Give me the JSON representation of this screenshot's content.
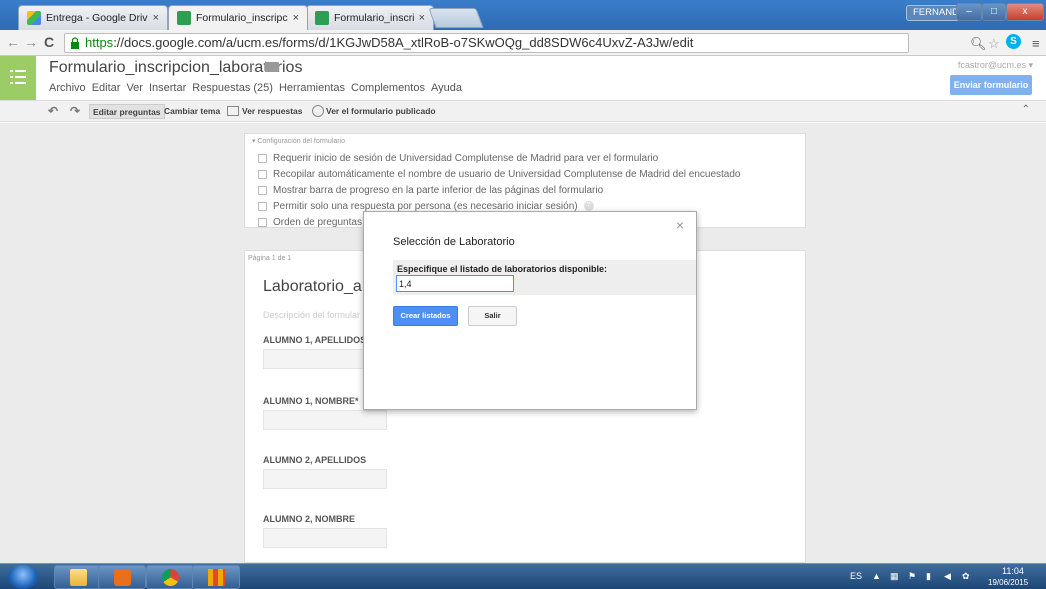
{
  "browser": {
    "tabs": [
      {
        "label": "Entrega - Google Drive",
        "close": "×"
      },
      {
        "label": "Formulario_inscripcion_lal",
        "close": "×"
      },
      {
        "label": "Formulario_inscripcion_lal",
        "close": "×"
      }
    ],
    "user": "FERNANDO",
    "url_scheme": "https",
    "url_rest": "://docs.google.com/a/ucm.es/forms/d/1KGJwD58A_xtlRoB-o7SKwOQg_dd8SDW6c4UxvZ-A3Jw/edit",
    "window_buttons": [
      "–",
      "□",
      "x"
    ]
  },
  "forms": {
    "doc_title": "Formulario_inscripcion_laboratorios",
    "star": "☆",
    "menu": [
      "Archivo",
      "Editar",
      "Ver",
      "Insertar",
      "Respuestas (25)",
      "Herramientas",
      "Complementos",
      "Ayuda"
    ],
    "account_email": "fcastror@ucm.es ▾",
    "send_label": "Enviar formulario"
  },
  "toolbar": {
    "undo": "↶",
    "redo": "↷",
    "edit_questions": "Editar preguntas",
    "change_theme": "Cambiar tema",
    "view_responses": "Ver respuestas",
    "view_published": "Ver el formulario publicado",
    "collapse": "⌃"
  },
  "settings": {
    "title": "▾ Configuración del formulario",
    "options": [
      "Requerir inicio de sesión de Universidad Complutense de Madrid para ver el formulario",
      "Recopilar automáticamente el nombre de usuario de Universidad Complutense de Madrid del encuestado",
      "Mostrar barra de progreso en la parte inferior de las páginas del formulario",
      "Permitir solo una respuesta por persona (es necesario iniciar sesión)",
      "Orden de preguntas a"
    ],
    "help": "?"
  },
  "page": {
    "label": "Página 1 de 1",
    "form_title": "Laboratorio_a",
    "description": "Descripción del formular",
    "questions": [
      "ALUMNO 1, APELLIDOS",
      "ALUMNO 1, NOMBRE*",
      "ALUMNO 2, APELLIDOS",
      "ALUMNO 2, NOMBRE"
    ]
  },
  "dialog": {
    "title": "Selección de Laboratorio",
    "close": "×",
    "prompt": "Especifique el listado de laboratorios disponible:",
    "input_value": "1,4",
    "create_label": "Crear listados",
    "exit_label": "Salir"
  },
  "taskbar": {
    "lang": "ES",
    "time": "11:04",
    "date": "19/06/2015"
  },
  "colors": {
    "forms_green": "#9ccc65",
    "primary_blue": "#4d8ff5",
    "send_blue": "#7fb1f0"
  }
}
